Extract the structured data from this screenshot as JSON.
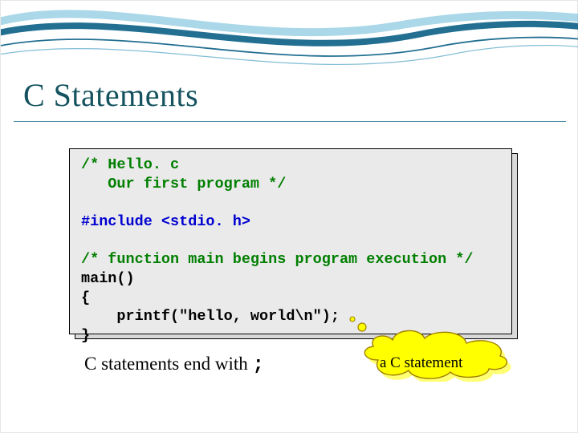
{
  "title": "C Statements",
  "code": {
    "line1": "/* Hello. c",
    "line2": "   Our first program */",
    "line3": "",
    "line4": "#include <stdio. h>",
    "line5": "",
    "line6": "/* function main begins program execution */",
    "line7": "main()",
    "line8": "{",
    "line9": "    printf(\"hello, world\\n\");",
    "line10": "}"
  },
  "footer": {
    "text": "C statements end with ",
    "semicolon": ";"
  },
  "callout": {
    "label": "a C statement"
  },
  "colors": {
    "title": "#14535f",
    "comment": "#007f00",
    "directive": "#0000d0",
    "cloud_fill": "#ffff00",
    "cloud_stroke": "#c0a000"
  }
}
